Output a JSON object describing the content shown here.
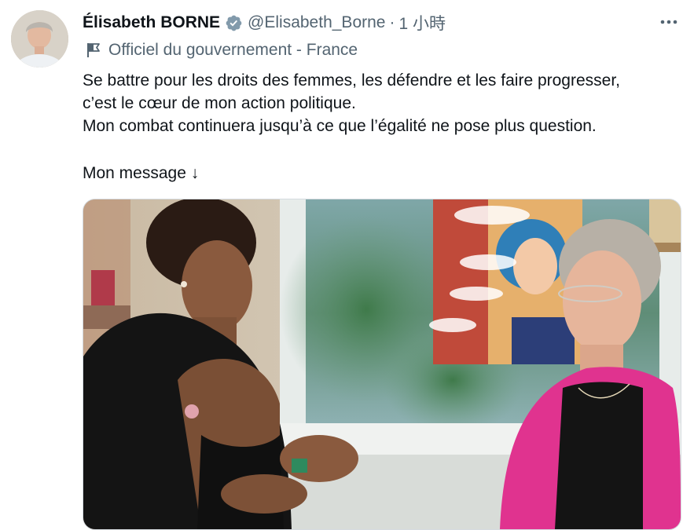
{
  "tweet": {
    "display_name": "Élisabeth BORNE",
    "handle": "@Elisabeth_Borne",
    "separator": "·",
    "time": "1 小時",
    "affiliation": "Officiel du gouvernement - France",
    "text_line_1": "Se battre pour les droits des femmes, les défendre et les faire progresser,",
    "text_line_2": "c’est le cœur de mon action politique.",
    "text_line_3": "Mon combat continuera jusqu’à ce que l’égalité ne pose plus question.",
    "text_line_4": "Mon message ↓"
  },
  "icons": {
    "verified": "verified-badge-icon",
    "more": "more-options-icon",
    "affiliation": "flag-icon"
  },
  "colors": {
    "text_primary": "#0f1419",
    "text_secondary": "#536471",
    "verified_badge": "#829aab"
  }
}
